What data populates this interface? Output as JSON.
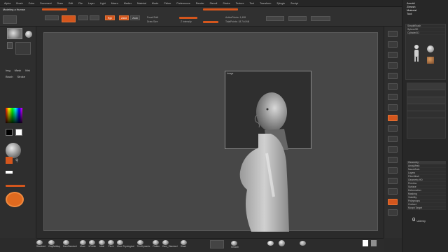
{
  "menu": [
    "Alpha",
    "Brush",
    "Color",
    "Document",
    "Draw",
    "Edit",
    "File",
    "Layer",
    "Light",
    "Macro",
    "Marker",
    "Material",
    "Movie",
    "Picker",
    "Preferences",
    "Render",
    "Stencil",
    "Stroke",
    "Texture",
    "Tool",
    "Transform",
    "Zplugin",
    "Zscript"
  ],
  "title": "Modeling a Human",
  "palette_title_right": [
    "Arnold",
    "Zbrush",
    "Material",
    "Tool"
  ],
  "shelf": {
    "rgb_label": "Rgb",
    "zadd_label": "Zadd",
    "zsub_label": "Zsub",
    "focal_label": "Focal Shift",
    "focal_value": "0",
    "draw_size_label": "Draw Size",
    "draw_size_value": "64",
    "intensity_label": "Z Intensity",
    "intensity_value": "25",
    "active_points": "ActivePoints: 1,408",
    "total_points": "TotalPoints: 18.744 Mil"
  },
  "left_panel": {
    "labels": [
      "Img",
      "Mask",
      "Mrk",
      "Brush",
      "Stroke"
    ]
  },
  "reference_box_label": "Image",
  "bottom_brushes": [
    "Standard",
    "ClayBuildup",
    "DamStandard",
    "Move",
    "hPolish",
    "Inflat",
    "Pinch",
    "Move Topological",
    "TrimDynamic",
    "Flatten",
    "Dam_Standard",
    "Slash",
    "Smooth"
  ],
  "tray_items": [
    "SimpleBrush",
    "Sphere3D",
    "Cylinder3D",
    "PM3D_Sphere3D",
    "Clone",
    "Make PolyMesh3D",
    "GoZ",
    "All",
    "Visible",
    "R",
    "Lightbox",
    "Tools",
    "Subtool",
    "Geometry",
    "ArrayMesh",
    "NanoMesh",
    "Layers",
    "FiberMesh",
    "Geometry HD",
    "Preview",
    "Surface",
    "Deformation",
    "Masking",
    "Visibility",
    "Polygroups",
    "Contact",
    "Morph Target"
  ],
  "watermark": "Udemy"
}
